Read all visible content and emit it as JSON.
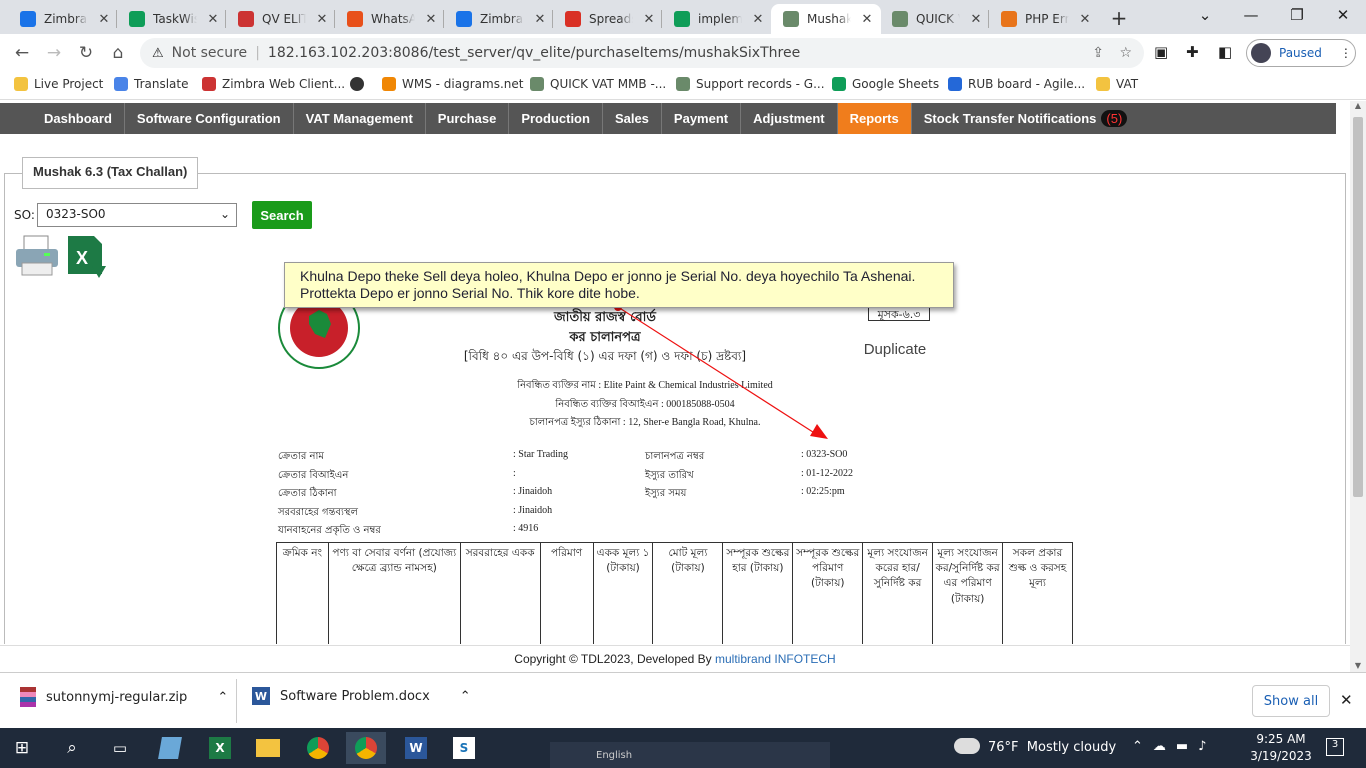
{
  "tabs": [
    {
      "label": "Zimbra: I",
      "icon": "zimbra-icon",
      "color": "#1a73e8"
    },
    {
      "label": "TaskWise",
      "icon": "sheets-icon",
      "color": "#0f9d58"
    },
    {
      "label": "QV ELITE",
      "icon": "qv-icon",
      "color": "#c33"
    },
    {
      "label": "WhatsApp",
      "icon": "alert-icon",
      "color": "#e8501a"
    },
    {
      "label": "Zimbra:",
      "icon": "zimbra-icon",
      "color": "#1a73e8"
    },
    {
      "label": "Spreadsh",
      "icon": "gmail-icon",
      "color": "#d93025"
    },
    {
      "label": "impleme",
      "icon": "sheets-icon",
      "color": "#0f9d58"
    },
    {
      "label": "Mushak",
      "icon": "gear-icon",
      "color": "#6a8a6a"
    },
    {
      "label": "QUICK V",
      "icon": "gear-icon",
      "color": "#6a8a6a"
    },
    {
      "label": "PHP Erro",
      "icon": "php-icon",
      "color": "#e8741a"
    }
  ],
  "address": {
    "security": "Not secure",
    "url": "182.163.102.203:8086/test_server/qv_elite/purchaseItems/mushakSixThree",
    "profile": "Paused"
  },
  "bookmarks": [
    {
      "label": "Live Project",
      "color": "#f3c340"
    },
    {
      "label": "Translate",
      "color": "#4a84e8"
    },
    {
      "label": "Zimbra Web Client...",
      "color": "#c33"
    },
    {
      "label": "",
      "color": "#333"
    },
    {
      "label": "WMS - diagrams.net",
      "color": "#f08705"
    },
    {
      "label": "QUICK VAT MMB -...",
      "color": "#6a8a6a"
    },
    {
      "label": "Support records - G...",
      "color": "#6a8a6a"
    },
    {
      "label": "Google Sheets",
      "color": "#0f9d58"
    },
    {
      "label": "RUB board - Agile...",
      "color": "#2468d8"
    },
    {
      "label": "VAT",
      "color": "#f3c340"
    }
  ],
  "menu": [
    {
      "label": "Dashboard"
    },
    {
      "label": "Software Configuration"
    },
    {
      "label": "VAT Management"
    },
    {
      "label": "Purchase"
    },
    {
      "label": "Production"
    },
    {
      "label": "Sales"
    },
    {
      "label": "Payment"
    },
    {
      "label": "Adjustment"
    },
    {
      "label": "Reports",
      "active": true
    },
    {
      "label": "Stock Transfer Notifications",
      "badge": "(5)"
    }
  ],
  "form": {
    "legend": "Mushak 6.3 (Tax Challan)",
    "so_label": "SO:",
    "so_value": "0323-SO0",
    "search": "Search"
  },
  "tooltip": {
    "line1": "Khulna Depo theke Sell deya holeo, Khulna Depo er jonno je Serial No. deya hoyechilo Ta Ashenai.",
    "line2": "Prottekta Depo er jonno Serial No. Thik kore dite hobe."
  },
  "doc": {
    "form_no": "মূসক-৬.৩",
    "title1": "জাতীয় রাজস্ব বোর্ড",
    "title2": "কর চালানপত্র",
    "rule": "[বিধি ৪০ এর উপ-বিধি (১) এর দফা (গ) ও দফা (চ) দ্রষ্টব্য]",
    "copy": "Duplicate",
    "reg_name": "নিবন্ধিত ব্যক্তির নাম : Elite Paint & Chemical Industries Limited",
    "reg_bin": "নিবন্ধিত ব্যক্তির বিআইএন : 000185088-0504",
    "issue_addr": "চালানপত্র ইস্যুর ঠিকানা : 12, Sher-e Bangla Road, Khulna.",
    "buyer": [
      {
        "label": "ক্রেতার নাম",
        "value": ": Star Trading"
      },
      {
        "label": "ক্রেতার বিআইএন",
        "value": ":"
      },
      {
        "label": "ক্রেতার ঠিকানা",
        "value": ": Jinaidoh"
      },
      {
        "label": "সরবরাহের গন্তব্যস্থল",
        "value": ": Jinaidoh"
      },
      {
        "label": "যানবাহনের প্রকৃতি ও নম্বর",
        "value": ": 4916"
      }
    ],
    "invoice": [
      {
        "label": "চালানপত্র নম্বর",
        "value": ": 0323-SO0"
      },
      {
        "label": "ইস্যুর তারিখ",
        "value": ": 01-12-2022"
      },
      {
        "label": "ইস্যুর সময়",
        "value": ": 02:25:pm"
      }
    ],
    "columns": [
      "ক্রমিক নং",
      "পণ্য বা সেবার বর্ণনা (প্রযোজ্য ক্ষেত্রে ব্র্যান্ড নামসহ)",
      "সরবরাহের একক",
      "পরিমাণ",
      "একক মূল্য ১ (টাকায়)",
      "মোট মূল্য (টাকায়)",
      "সম্পূরক শুল্কের হার (টাকায়)",
      "সম্পূরক শুল্কের পরিমাণ (টাকায়)",
      "মূল্য সংযোজন করের হার/ সুনির্দিষ্ট কর",
      "মূল্য সংযোজন কর/সুনির্দিষ্ট কর এর পরিমাণ (টাকায়)",
      "সকল প্রকার শুল্ক ও করসহ মূল্য"
    ],
    "emblem_text": "গণপ্রজাতন্ত্রী বাংলাদেশ সরকার"
  },
  "footer": {
    "prefix": "Copyright © TDL2023, Developed By ",
    "link": "multibrand INFOTECH"
  },
  "downloads": {
    "items": [
      {
        "label": "sutonnymj-regular.zip"
      },
      {
        "label": "Software Problem.docx"
      }
    ],
    "show_all": "Show all"
  },
  "taskbar": {
    "weather": "76°F  Mostly cloudy",
    "language": "English",
    "time": "9:25 AM",
    "date": "3/19/2023",
    "notif": "3"
  }
}
